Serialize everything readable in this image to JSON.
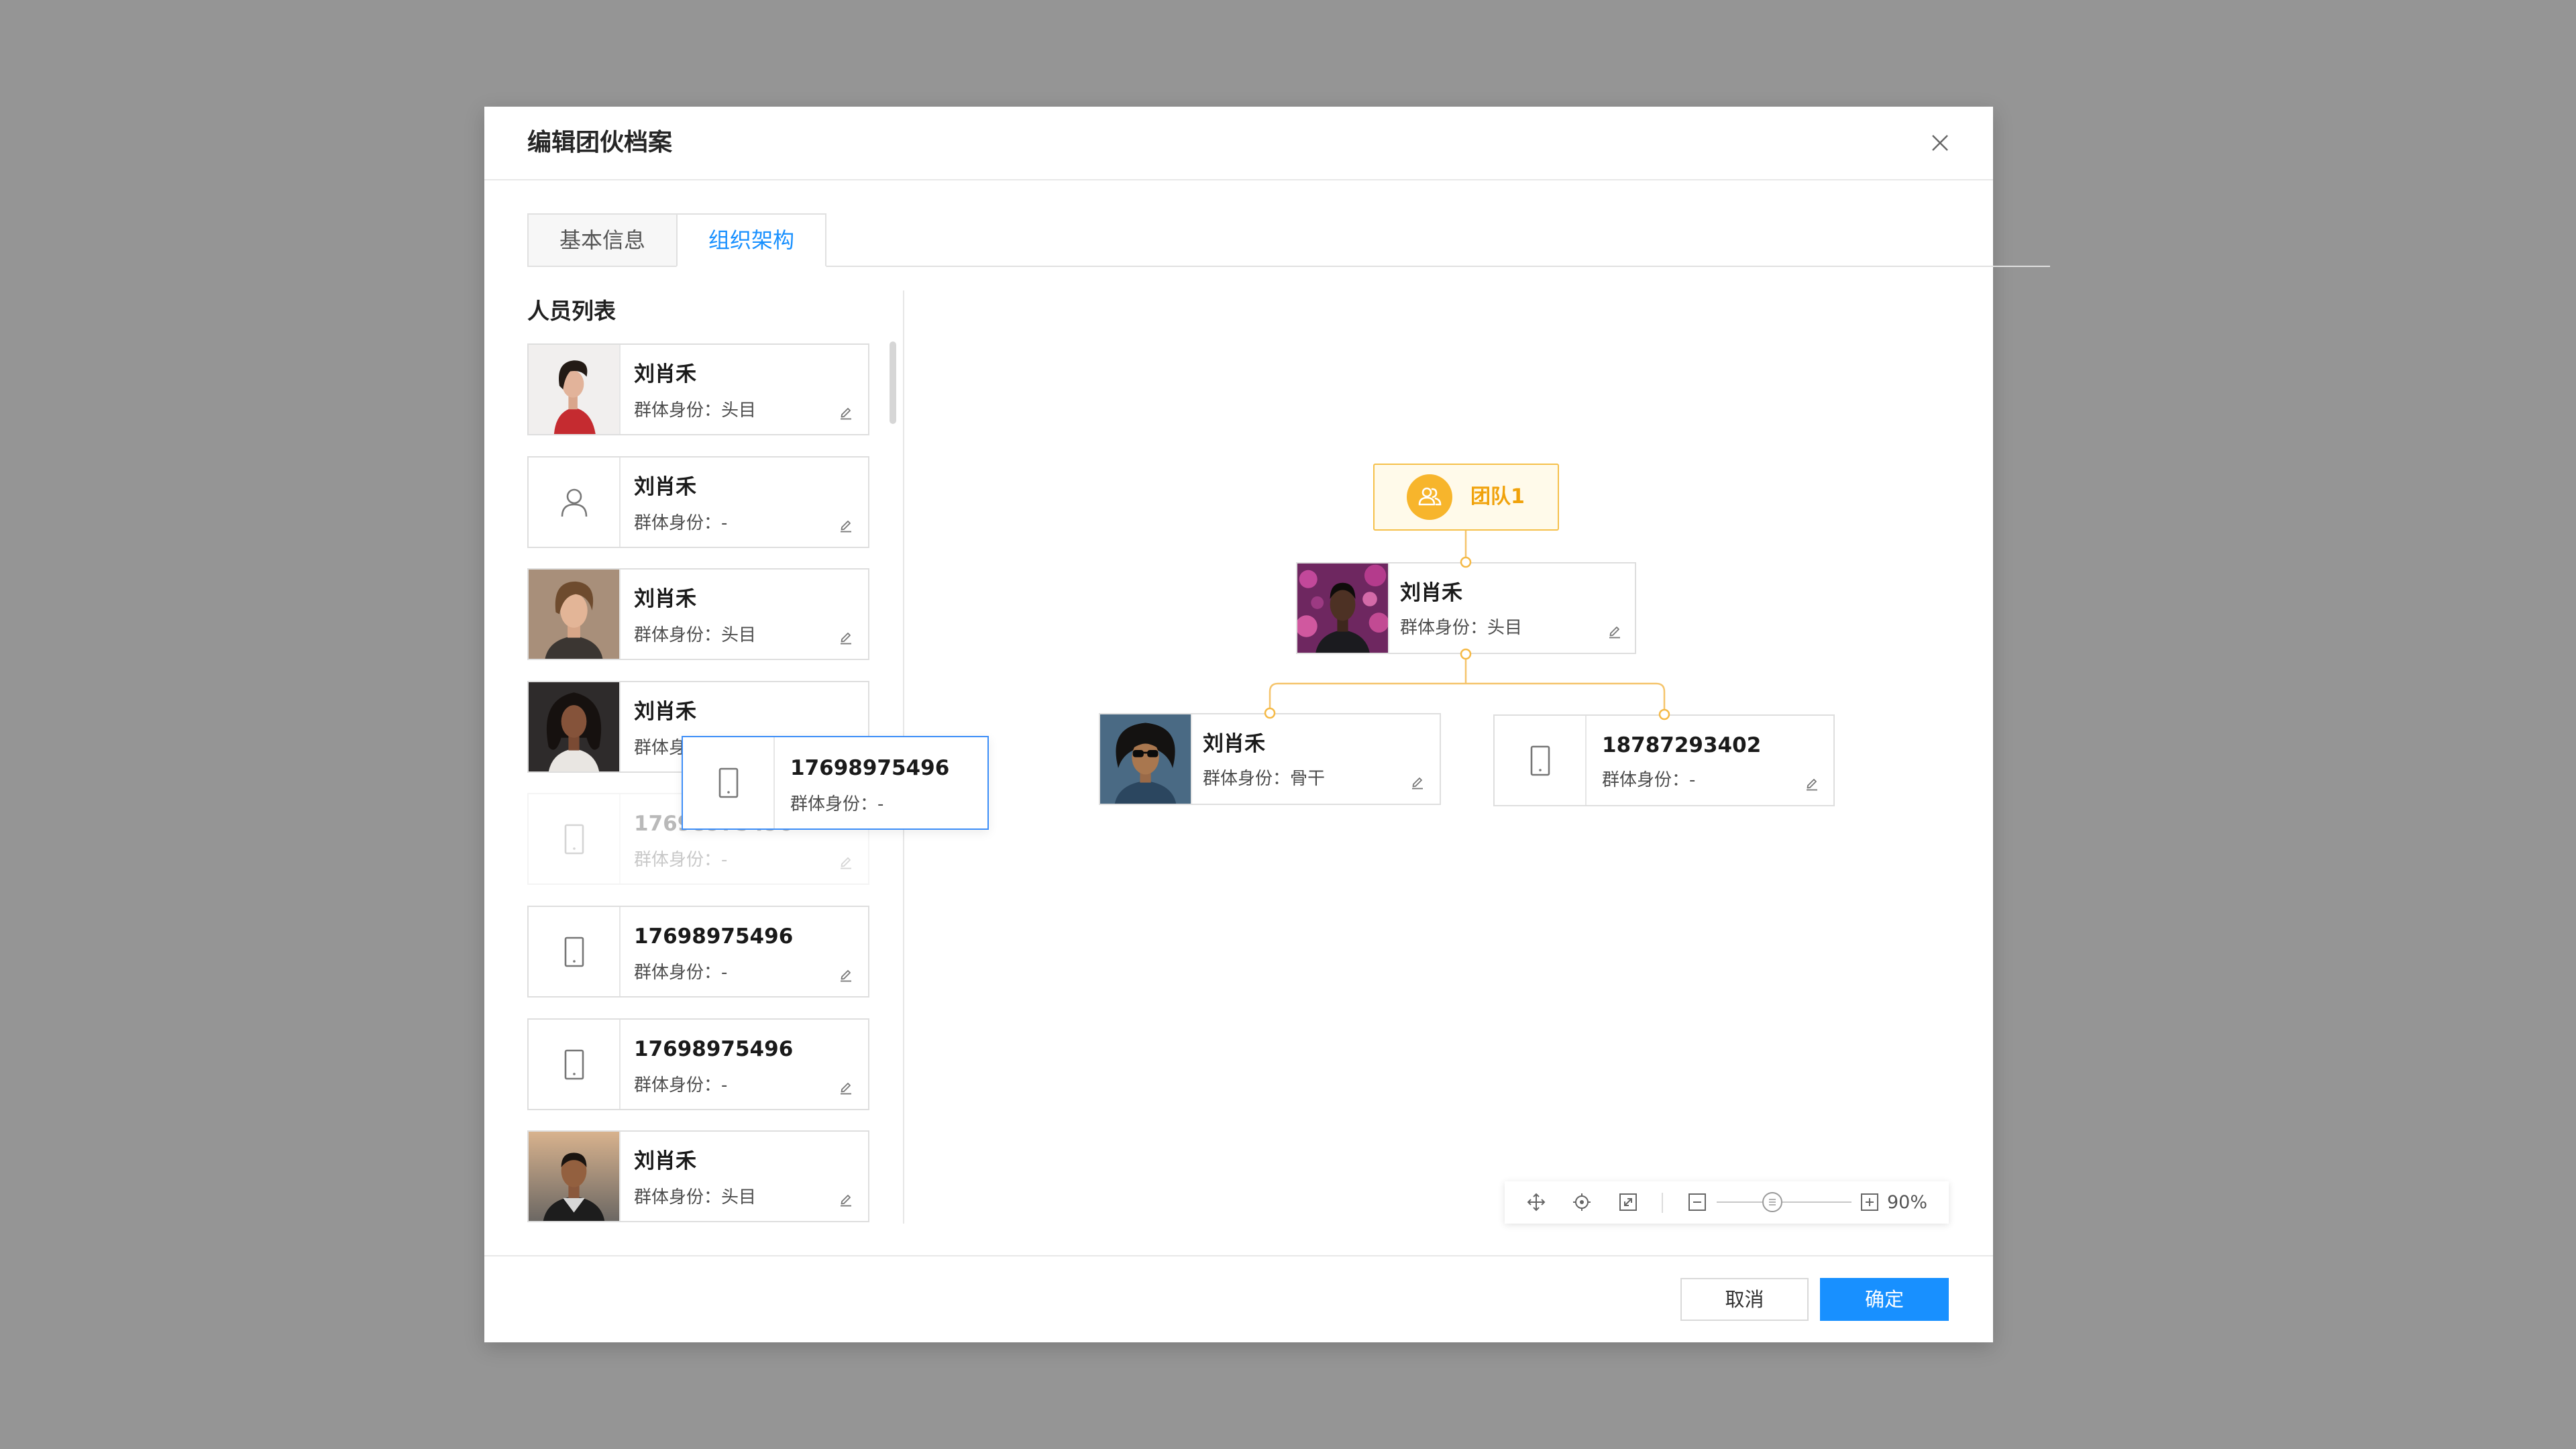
{
  "dialog": {
    "title": "编辑团伙档案"
  },
  "tabs": [
    {
      "label": "基本信息",
      "active": false
    },
    {
      "label": "组织架构",
      "active": true
    }
  ],
  "member_list": {
    "title": "人员列表",
    "role_label": "群体身份：",
    "items": [
      {
        "name": "刘肖禾",
        "role": "头目"
      },
      {
        "name": "刘肖禾",
        "role": "-",
        "icon": "person-icon"
      },
      {
        "name": "刘肖禾",
        "role": "头目"
      },
      {
        "name": "刘肖禾",
        "role": ""
      },
      {
        "name": "17698975496",
        "role": "-",
        "icon": "phone-icon",
        "placeholder": true
      },
      {
        "name": "17698975496",
        "role": "-",
        "icon": "phone-icon"
      },
      {
        "name": "17698975496",
        "role": "-",
        "icon": "phone-icon"
      },
      {
        "name": "刘肖禾",
        "role": "头目"
      }
    ]
  },
  "dragging_item": {
    "name": "17698975496",
    "role": "-",
    "icon": "phone-icon"
  },
  "org_chart": {
    "team": {
      "name": "团队1",
      "icon": "team-icon"
    },
    "leader": {
      "name": "刘肖禾",
      "role": "头目"
    },
    "members": [
      {
        "name": "刘肖禾",
        "role": "骨干"
      },
      {
        "name": "18787293402",
        "role": "-",
        "icon": "phone-icon"
      }
    ]
  },
  "zoom_toolbar": {
    "zoom_label": "90%",
    "zoom_percent": 90
  },
  "footer": {
    "cancel_label": "取消",
    "confirm_label": "确定"
  },
  "colors": {
    "accent": "#1890ff",
    "team": "#f7b52c",
    "connector": "#f5c46b",
    "drag_border": "#3d8ef8"
  }
}
